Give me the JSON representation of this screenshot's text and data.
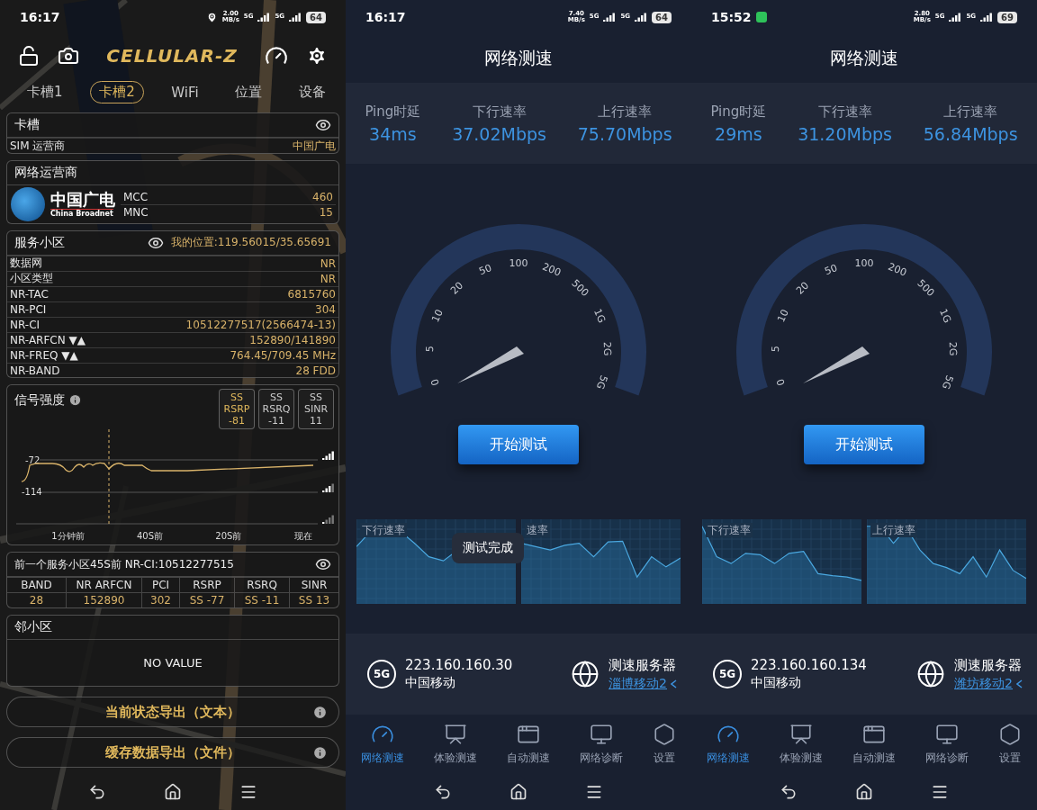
{
  "cellular_z": {
    "status_bar": {
      "time": "16:17",
      "location": true,
      "chat_notification": false,
      "speed": "2.00",
      "speed_unit": "MB/s",
      "networks": [
        "5G",
        "5G"
      ],
      "battery": "64"
    },
    "logo": "CELLULAR-Z",
    "tabs": [
      {
        "label": "卡槽1",
        "selected": false
      },
      {
        "label": "卡槽2",
        "selected": true
      },
      {
        "label": "WiFi",
        "selected": false
      },
      {
        "label": "位置",
        "selected": false
      },
      {
        "label": "设备",
        "selected": false
      }
    ],
    "slot_card": {
      "title": "卡槽",
      "rows": [
        {
          "label": "SIM 运营商",
          "value": "中国广电"
        }
      ]
    },
    "operator_card": {
      "title": "网络运营商",
      "logo_name": "中国广电",
      "logo_sub": "China Broadnet",
      "rows": [
        {
          "label": "MCC",
          "value": "460"
        },
        {
          "label": "MNC",
          "value": "15"
        }
      ]
    },
    "serving_cell": {
      "title": "服务小区",
      "location": "我的位置:119.56015/35.65691",
      "rows": [
        {
          "label": "数据网",
          "value": "NR"
        },
        {
          "label": "小区类型",
          "value": "NR"
        },
        {
          "label": "NR-TAC",
          "value": "6815760"
        },
        {
          "label": "NR-PCI",
          "value": "304"
        },
        {
          "label": "NR-CI",
          "value": "10512277517(2566474-13)"
        },
        {
          "label": "NR-ARFCN ▼▲",
          "value": "152890/141890"
        },
        {
          "label": "NR-FREQ ▼▲",
          "value": "764.45/709.45 MHz"
        },
        {
          "label": "NR-BAND",
          "value": "28 FDD"
        }
      ]
    },
    "signal": {
      "title": "信号强度",
      "badges": [
        {
          "prefix": "SS",
          "metric": "RSRP",
          "value": "-81",
          "selected": true
        },
        {
          "prefix": "SS",
          "metric": "RSRQ",
          "value": "-11",
          "selected": false
        },
        {
          "prefix": "SS",
          "metric": "SINR",
          "value": "11",
          "selected": false
        }
      ],
      "y_labels": [
        "-72",
        "-114"
      ],
      "x_labels": [
        "1分钟前",
        "40S前",
        "20S前",
        "现在"
      ]
    },
    "previous_cell": {
      "title": "前一个服务小区45S前 NR-CI:10512277515",
      "columns": [
        "BAND",
        "NR ARFCN",
        "PCI",
        "RSRP",
        "RSRQ",
        "SINR"
      ],
      "values": [
        "28",
        "152890",
        "302",
        "SS -77",
        "SS -11",
        "SS 13"
      ]
    },
    "neighbor_cells": {
      "title": "邻小区",
      "empty": "NO VALUE"
    },
    "actions": [
      "当前状态导出（文本）",
      "缓存数据导出（文件）"
    ]
  },
  "speed_tests": [
    {
      "status_bar": {
        "time": "16:17",
        "location": false,
        "chat_notification": false,
        "speed": "7.40",
        "speed_unit": "MB/s",
        "networks": [
          "5G",
          "5G"
        ],
        "battery": "64"
      },
      "title": "网络测速",
      "metrics": [
        {
          "label": "Ping时延",
          "value": "34ms"
        },
        {
          "label": "下行速率",
          "value": "37.02Mbps"
        },
        {
          "label": "上行速率",
          "value": "75.70Mbps"
        }
      ],
      "gauge_ticks": [
        "0",
        "5",
        "10",
        "20",
        "50",
        "100",
        "200",
        "500",
        "1G",
        "2G",
        "5G"
      ],
      "start_button": "开始测试",
      "graphs": [
        {
          "label": "下行速率"
        },
        {
          "label": "速率"
        }
      ],
      "toast": "测试完成",
      "network_badge": "5G",
      "ip": "223.160.160.30",
      "carrier": "中国移动",
      "server_title": "测速服务器",
      "server": "淄博移动2",
      "tabs": [
        {
          "label": "网络测速",
          "selected": true
        },
        {
          "label": "体验测速",
          "selected": false
        },
        {
          "label": "自动测速",
          "selected": false
        },
        {
          "label": "网络诊断",
          "selected": false
        },
        {
          "label": "设置",
          "selected": false
        }
      ]
    },
    {
      "status_bar": {
        "time": "15:52",
        "location": false,
        "chat_notification": true,
        "speed": "2.80",
        "speed_unit": "MB/s",
        "networks": [
          "5G",
          "5G"
        ],
        "battery": "69"
      },
      "title": "网络测速",
      "metrics": [
        {
          "label": "Ping时延",
          "value": "29ms"
        },
        {
          "label": "下行速率",
          "value": "31.20Mbps"
        },
        {
          "label": "上行速率",
          "value": "56.84Mbps"
        }
      ],
      "gauge_ticks": [
        "0",
        "5",
        "10",
        "20",
        "50",
        "100",
        "200",
        "500",
        "1G",
        "2G",
        "5G"
      ],
      "start_button": "开始测试",
      "graphs": [
        {
          "label": "下行速率"
        },
        {
          "label": "上行速率"
        }
      ],
      "network_badge": "5G",
      "ip": "223.160.160.134",
      "carrier": "中国移动",
      "server_title": "测速服务器",
      "server": "潍坊移动2",
      "tabs": [
        {
          "label": "网络测速",
          "selected": true
        },
        {
          "label": "体验测速",
          "selected": false
        },
        {
          "label": "自动测速",
          "selected": false
        },
        {
          "label": "网络诊断",
          "selected": false
        },
        {
          "label": "设置",
          "selected": false
        }
      ]
    }
  ]
}
